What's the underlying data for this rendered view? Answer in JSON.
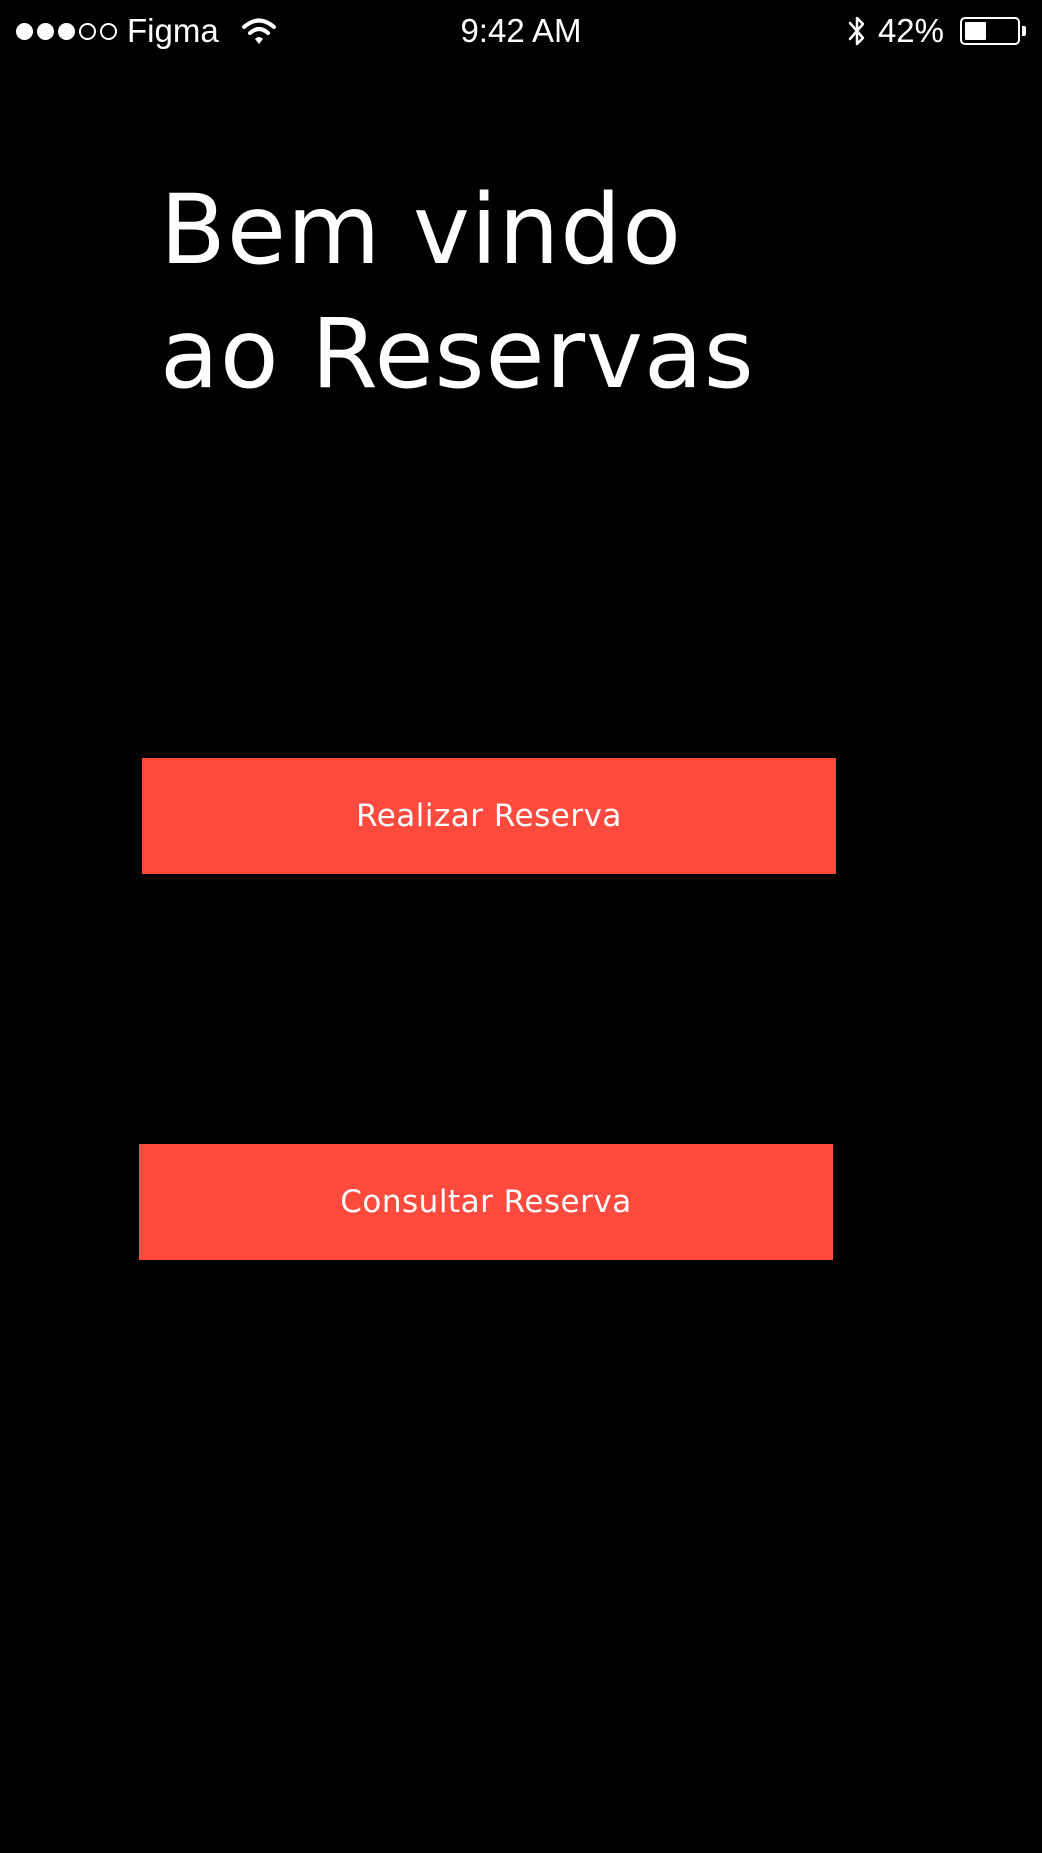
{
  "status_bar": {
    "carrier": "Figma",
    "signal_bars_filled": 3,
    "signal_bars_total": 5,
    "time": "9:42 AM",
    "battery_percent_label": "42%",
    "battery_level": 0.42,
    "icons": [
      "wifi-icon",
      "bluetooth-icon",
      "battery-icon"
    ]
  },
  "welcome": {
    "line1": "Bem vindo",
    "line2": "ao Reservas"
  },
  "actions": {
    "make_reservation_label": "Realizar Reserva",
    "check_reservation_label": "Consultar Reserva"
  },
  "colors": {
    "background": "#000000",
    "accent": "#ff4a3d",
    "text": "#ffffff"
  }
}
